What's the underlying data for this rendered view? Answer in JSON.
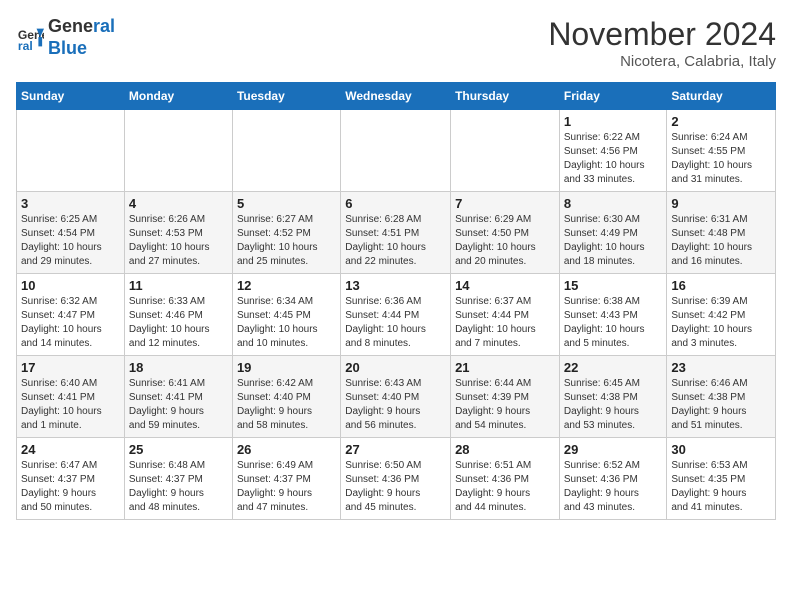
{
  "header": {
    "logo_line1": "General",
    "logo_line2": "Blue",
    "month": "November 2024",
    "location": "Nicotera, Calabria, Italy"
  },
  "weekdays": [
    "Sunday",
    "Monday",
    "Tuesday",
    "Wednesday",
    "Thursday",
    "Friday",
    "Saturday"
  ],
  "weeks": [
    [
      {
        "day": "",
        "info": ""
      },
      {
        "day": "",
        "info": ""
      },
      {
        "day": "",
        "info": ""
      },
      {
        "day": "",
        "info": ""
      },
      {
        "day": "",
        "info": ""
      },
      {
        "day": "1",
        "info": "Sunrise: 6:22 AM\nSunset: 4:56 PM\nDaylight: 10 hours\nand 33 minutes."
      },
      {
        "day": "2",
        "info": "Sunrise: 6:24 AM\nSunset: 4:55 PM\nDaylight: 10 hours\nand 31 minutes."
      }
    ],
    [
      {
        "day": "3",
        "info": "Sunrise: 6:25 AM\nSunset: 4:54 PM\nDaylight: 10 hours\nand 29 minutes."
      },
      {
        "day": "4",
        "info": "Sunrise: 6:26 AM\nSunset: 4:53 PM\nDaylight: 10 hours\nand 27 minutes."
      },
      {
        "day": "5",
        "info": "Sunrise: 6:27 AM\nSunset: 4:52 PM\nDaylight: 10 hours\nand 25 minutes."
      },
      {
        "day": "6",
        "info": "Sunrise: 6:28 AM\nSunset: 4:51 PM\nDaylight: 10 hours\nand 22 minutes."
      },
      {
        "day": "7",
        "info": "Sunrise: 6:29 AM\nSunset: 4:50 PM\nDaylight: 10 hours\nand 20 minutes."
      },
      {
        "day": "8",
        "info": "Sunrise: 6:30 AM\nSunset: 4:49 PM\nDaylight: 10 hours\nand 18 minutes."
      },
      {
        "day": "9",
        "info": "Sunrise: 6:31 AM\nSunset: 4:48 PM\nDaylight: 10 hours\nand 16 minutes."
      }
    ],
    [
      {
        "day": "10",
        "info": "Sunrise: 6:32 AM\nSunset: 4:47 PM\nDaylight: 10 hours\nand 14 minutes."
      },
      {
        "day": "11",
        "info": "Sunrise: 6:33 AM\nSunset: 4:46 PM\nDaylight: 10 hours\nand 12 minutes."
      },
      {
        "day": "12",
        "info": "Sunrise: 6:34 AM\nSunset: 4:45 PM\nDaylight: 10 hours\nand 10 minutes."
      },
      {
        "day": "13",
        "info": "Sunrise: 6:36 AM\nSunset: 4:44 PM\nDaylight: 10 hours\nand 8 minutes."
      },
      {
        "day": "14",
        "info": "Sunrise: 6:37 AM\nSunset: 4:44 PM\nDaylight: 10 hours\nand 7 minutes."
      },
      {
        "day": "15",
        "info": "Sunrise: 6:38 AM\nSunset: 4:43 PM\nDaylight: 10 hours\nand 5 minutes."
      },
      {
        "day": "16",
        "info": "Sunrise: 6:39 AM\nSunset: 4:42 PM\nDaylight: 10 hours\nand 3 minutes."
      }
    ],
    [
      {
        "day": "17",
        "info": "Sunrise: 6:40 AM\nSunset: 4:41 PM\nDaylight: 10 hours\nand 1 minute."
      },
      {
        "day": "18",
        "info": "Sunrise: 6:41 AM\nSunset: 4:41 PM\nDaylight: 9 hours\nand 59 minutes."
      },
      {
        "day": "19",
        "info": "Sunrise: 6:42 AM\nSunset: 4:40 PM\nDaylight: 9 hours\nand 58 minutes."
      },
      {
        "day": "20",
        "info": "Sunrise: 6:43 AM\nSunset: 4:40 PM\nDaylight: 9 hours\nand 56 minutes."
      },
      {
        "day": "21",
        "info": "Sunrise: 6:44 AM\nSunset: 4:39 PM\nDaylight: 9 hours\nand 54 minutes."
      },
      {
        "day": "22",
        "info": "Sunrise: 6:45 AM\nSunset: 4:38 PM\nDaylight: 9 hours\nand 53 minutes."
      },
      {
        "day": "23",
        "info": "Sunrise: 6:46 AM\nSunset: 4:38 PM\nDaylight: 9 hours\nand 51 minutes."
      }
    ],
    [
      {
        "day": "24",
        "info": "Sunrise: 6:47 AM\nSunset: 4:37 PM\nDaylight: 9 hours\nand 50 minutes."
      },
      {
        "day": "25",
        "info": "Sunrise: 6:48 AM\nSunset: 4:37 PM\nDaylight: 9 hours\nand 48 minutes."
      },
      {
        "day": "26",
        "info": "Sunrise: 6:49 AM\nSunset: 4:37 PM\nDaylight: 9 hours\nand 47 minutes."
      },
      {
        "day": "27",
        "info": "Sunrise: 6:50 AM\nSunset: 4:36 PM\nDaylight: 9 hours\nand 45 minutes."
      },
      {
        "day": "28",
        "info": "Sunrise: 6:51 AM\nSunset: 4:36 PM\nDaylight: 9 hours\nand 44 minutes."
      },
      {
        "day": "29",
        "info": "Sunrise: 6:52 AM\nSunset: 4:36 PM\nDaylight: 9 hours\nand 43 minutes."
      },
      {
        "day": "30",
        "info": "Sunrise: 6:53 AM\nSunset: 4:35 PM\nDaylight: 9 hours\nand 41 minutes."
      }
    ]
  ]
}
